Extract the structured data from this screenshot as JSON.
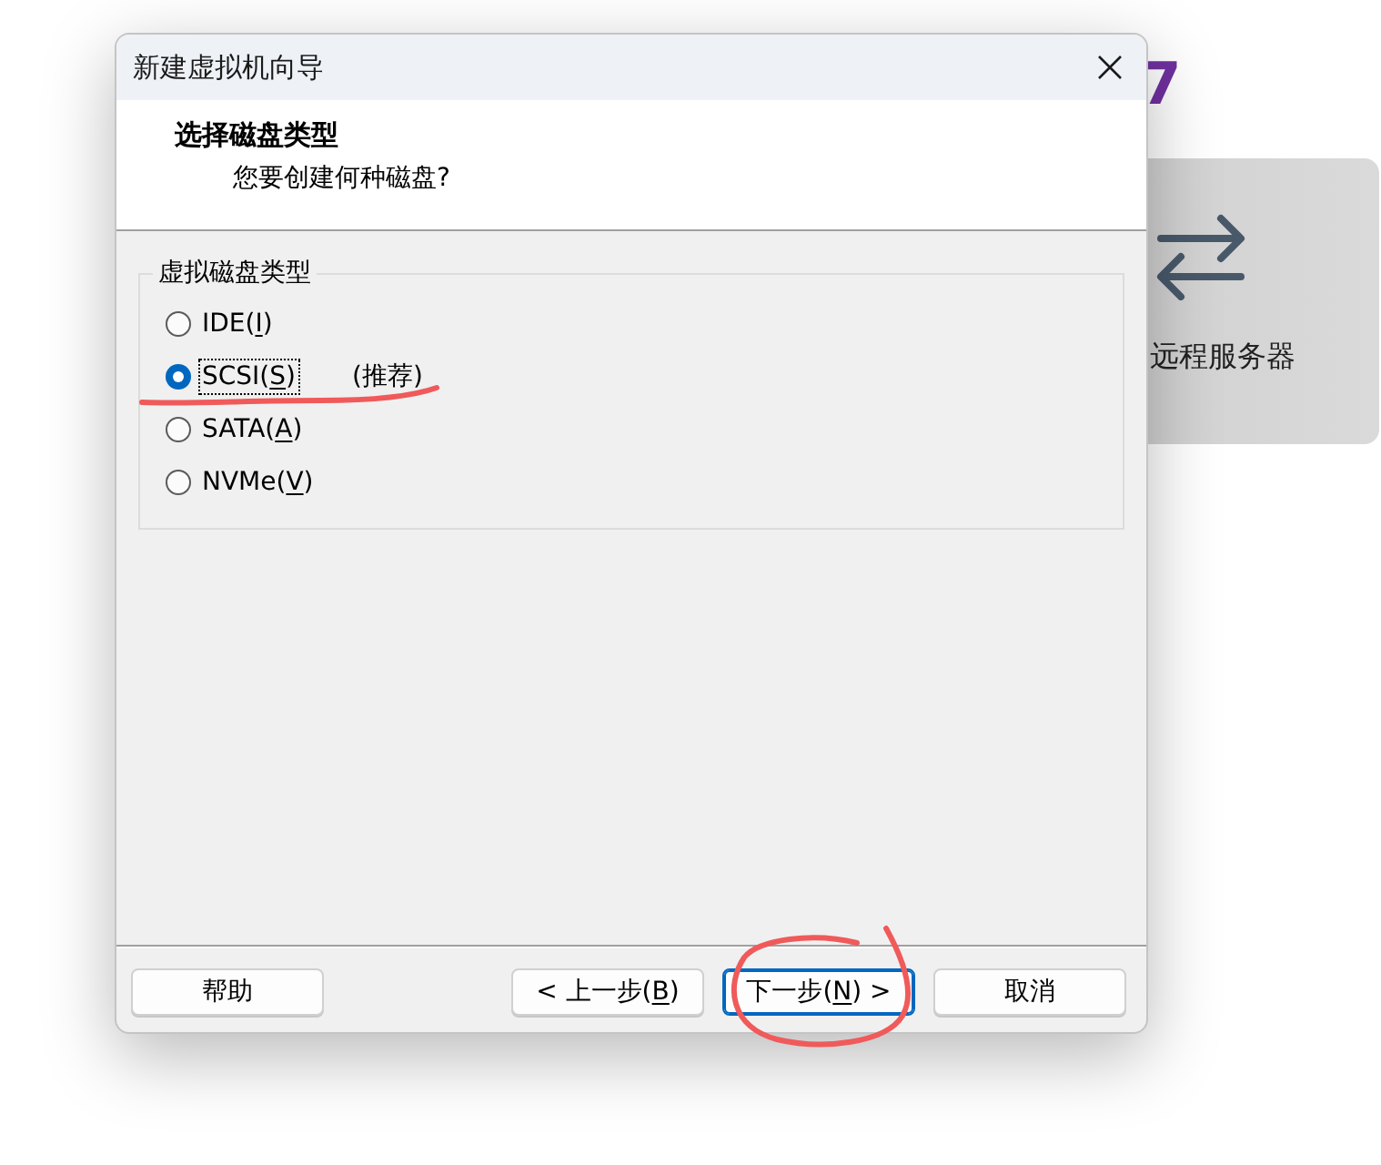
{
  "background_page": {
    "heading_fragment": "7",
    "card": {
      "label": "远程服务器"
    }
  },
  "dialog": {
    "title": "新建虚拟机向导",
    "header": {
      "title": "选择磁盘类型",
      "subtitle": "您要创建何种磁盘?"
    },
    "group": {
      "legend": "虚拟磁盘类型",
      "options": [
        {
          "label_start": "IDE(",
          "hotkey": "I",
          "label_end": ")",
          "selected": false,
          "focused": false
        },
        {
          "label_start": "SCSI(",
          "hotkey": "S",
          "label_end": ")",
          "note": "(推荐)",
          "selected": true,
          "focused": true
        },
        {
          "label_start": "SATA(",
          "hotkey": "A",
          "label_end": ")",
          "selected": false,
          "focused": false
        },
        {
          "label_start": "NVMe(",
          "hotkey": "V",
          "label_end": ")",
          "selected": false,
          "focused": false
        }
      ]
    },
    "buttons": [
      {
        "label_start": "帮助",
        "default": false
      },
      {
        "label_start": "< 上一步(",
        "hotkey": "B",
        "label_end": ")",
        "default": false
      },
      {
        "label_start": "下一步(",
        "hotkey": "N",
        "label_end": ") >",
        "default": true
      },
      {
        "label_start": "取消",
        "default": false
      }
    ]
  }
}
